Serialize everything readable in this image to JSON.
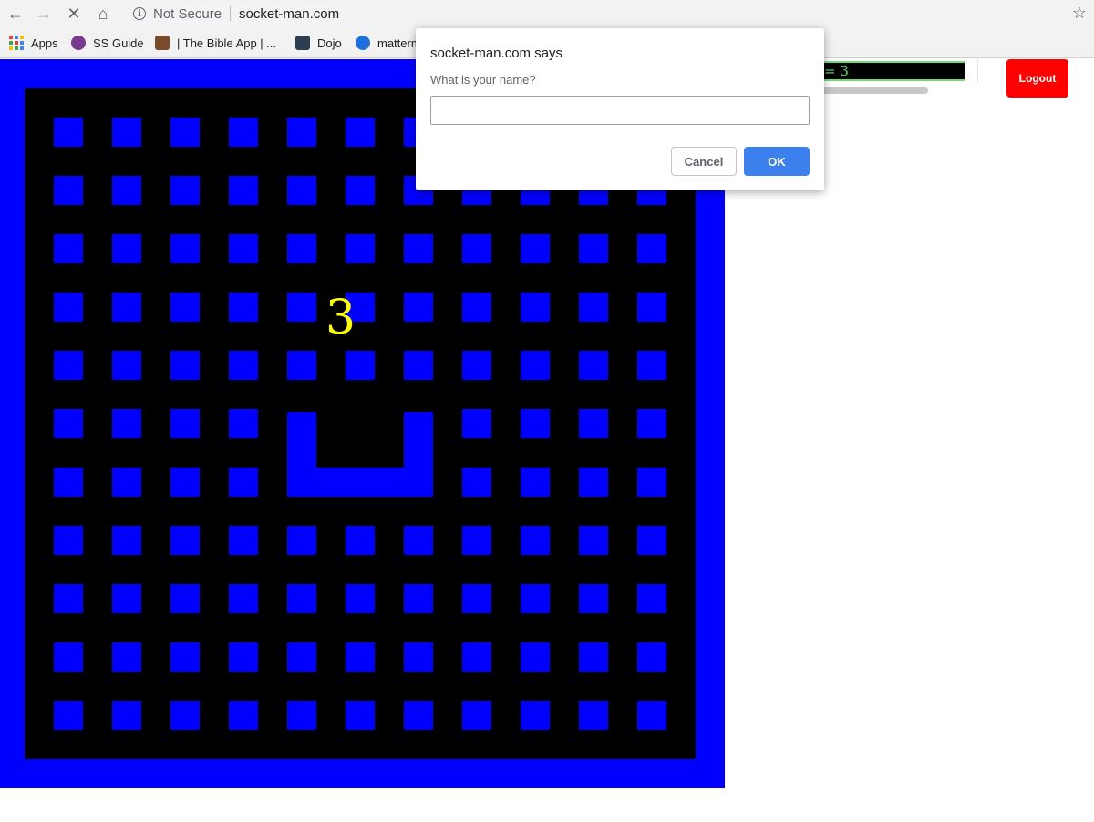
{
  "browser": {
    "security_label": "Not Secure",
    "url": "socket-man.com"
  },
  "bookmarks": [
    {
      "label": "Apps",
      "icon": "apps-grid-icon"
    },
    {
      "label": "SS Guide",
      "icon": "ss-guide-icon"
    },
    {
      "label": "| The Bible App | ...",
      "icon": "bible-app-icon"
    },
    {
      "label": "Dojo",
      "icon": "dojo-icon"
    },
    {
      "label": "matterm",
      "icon": "mattermost-icon"
    }
  ],
  "game": {
    "countdown": "3",
    "colors": {
      "wall": "#0000ff",
      "floor": "#000000",
      "countdown": "#ffff00"
    }
  },
  "scoreboard": {
    "text": "= 3"
  },
  "logout_label": "Logout",
  "dialog": {
    "title": "socket-man.com says",
    "message": "What is your name?",
    "input_value": "",
    "cancel_label": "Cancel",
    "ok_label": "OK"
  }
}
